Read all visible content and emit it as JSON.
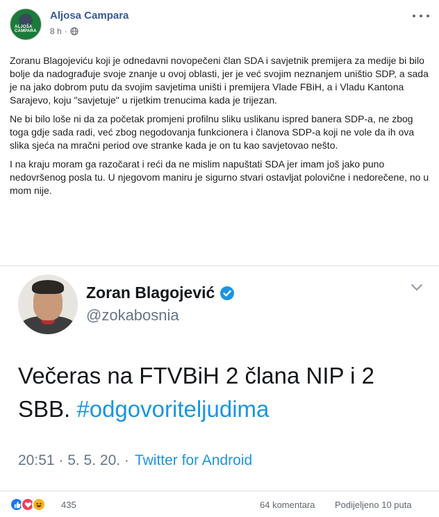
{
  "post": {
    "author": "Aljosa Campara",
    "avatar_text": "ALJOŠA CAMPARA",
    "time": "8 h",
    "time_separator": "·",
    "paragraphs": [
      "Zoranu Blagojeviću koji je odnedavni novopečeni član SDA i savjetnik premijera za medije bi bilo bolje da nadograđuje svoje znanje u ovoj oblasti, jer je već svojim neznanjem uništio SDP, a sada je na jako dobrom putu da svojim savjetima uništi i premijera Vlade FBiH, a i Vladu Kantona Sarajevo, koju \"savjetuje\" u rijetkim trenucima kada je trijezan.",
      "Ne bi bilo loše ni da za početak promjeni profilnu sliku uslikanu ispred banera SDP-a, ne zbog toga gdje sada radi, već zbog negodovanja funkcionera i članova SDP-a koji ne vole da ih ova slika sjeća na mračni period ove stranke kada je on tu kao savjetovao nešto.",
      "I na kraju moram ga razočarat i reći da ne mislim napuštati SDA jer imam još jako puno nedovršenog posla tu. U njegovom maniru je sigurno stvari ostavljat polovične i nedorečene, no u mom nije."
    ]
  },
  "tweet": {
    "name": "Zoran Blagojević",
    "handle": "@zokabosnia",
    "text_main": "Večeras na FTVBiH 2 člana NIP i 2 SBB. ",
    "hashtag": "#odgovoriteljudima",
    "time": "20:51 · 5. 5. 20. ·",
    "source": "Twitter for Android"
  },
  "footer": {
    "reaction_count": "435",
    "comments": "64 komentara",
    "shares": "Podijeljeno 10 puta"
  },
  "colors": {
    "link_blue": "#385898",
    "twitter_blue": "#1b95e0",
    "like": "#1877f2",
    "love": "#f33e58",
    "haha": "#f7b125"
  },
  "icons": [
    "globe-icon",
    "more-icon",
    "verified-icon",
    "chevron-down-icon",
    "like-icon",
    "love-icon",
    "haha-icon"
  ]
}
